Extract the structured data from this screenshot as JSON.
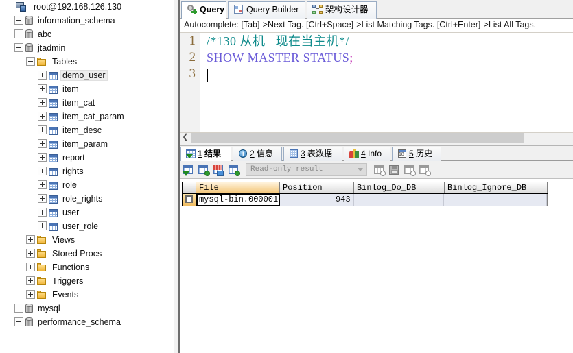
{
  "tree": {
    "root": {
      "label": "root@192.168.126.130",
      "icon": "server-icon"
    },
    "nodes": [
      {
        "label": "information_schema",
        "icon": "database-icon",
        "indent": 1,
        "toggle": "plus"
      },
      {
        "label": "abc",
        "icon": "database-icon",
        "indent": 1,
        "toggle": "plus"
      },
      {
        "label": "jtadmin",
        "icon": "database-icon",
        "indent": 1,
        "toggle": "minus"
      },
      {
        "label": "Tables",
        "icon": "folder-icon",
        "indent": 2,
        "toggle": "minus"
      },
      {
        "label": "demo_user",
        "icon": "table-icon",
        "indent": 3,
        "toggle": "plus",
        "selected": true
      },
      {
        "label": "item",
        "icon": "table-icon",
        "indent": 3,
        "toggle": "plus"
      },
      {
        "label": "item_cat",
        "icon": "table-icon",
        "indent": 3,
        "toggle": "plus"
      },
      {
        "label": "item_cat_param",
        "icon": "table-icon",
        "indent": 3,
        "toggle": "plus"
      },
      {
        "label": "item_desc",
        "icon": "table-icon",
        "indent": 3,
        "toggle": "plus"
      },
      {
        "label": "item_param",
        "icon": "table-icon",
        "indent": 3,
        "toggle": "plus"
      },
      {
        "label": "report",
        "icon": "table-icon",
        "indent": 3,
        "toggle": "plus"
      },
      {
        "label": "rights",
        "icon": "table-icon",
        "indent": 3,
        "toggle": "plus"
      },
      {
        "label": "role",
        "icon": "table-icon",
        "indent": 3,
        "toggle": "plus"
      },
      {
        "label": "role_rights",
        "icon": "table-icon",
        "indent": 3,
        "toggle": "plus"
      },
      {
        "label": "user",
        "icon": "table-icon",
        "indent": 3,
        "toggle": "plus"
      },
      {
        "label": "user_role",
        "icon": "table-icon",
        "indent": 3,
        "toggle": "plus"
      },
      {
        "label": "Views",
        "icon": "folder-icon",
        "indent": 2,
        "toggle": "plus"
      },
      {
        "label": "Stored Procs",
        "icon": "folder-icon",
        "indent": 2,
        "toggle": "plus"
      },
      {
        "label": "Functions",
        "icon": "folder-icon",
        "indent": 2,
        "toggle": "plus"
      },
      {
        "label": "Triggers",
        "icon": "folder-icon",
        "indent": 2,
        "toggle": "plus"
      },
      {
        "label": "Events",
        "icon": "folder-icon",
        "indent": 2,
        "toggle": "plus"
      },
      {
        "label": "mysql",
        "icon": "database-icon",
        "indent": 1,
        "toggle": "plus"
      },
      {
        "label": "performance_schema",
        "icon": "database-icon",
        "indent": 1,
        "toggle": "plus"
      }
    ]
  },
  "tabs": [
    {
      "label": "Query",
      "icon": "query-icon",
      "active": true
    },
    {
      "label": "Query Builder",
      "icon": "query-builder-icon",
      "active": false
    },
    {
      "label": "架构设计器",
      "icon": "schema-designer-icon",
      "active": false
    }
  ],
  "autocomplete_hint": "Autocomplete: [Tab]->Next Tag. [Ctrl+Space]->List Matching Tags. [Ctrl+Enter]->List All Tags.",
  "editor": {
    "line_numbers": [
      "1",
      "2",
      "3"
    ],
    "lines": [
      {
        "comment": "/*130 从机   现在当主机*/"
      },
      {
        "keywords": "SHOW MASTER STATUS",
        "punct": ";"
      },
      {
        "empty": ""
      }
    ],
    "colors": {
      "comment": "#0d8a8a",
      "keyword": "#6a5bd8",
      "punctuation": "#c02ab0",
      "lineno": "#8a6b3a"
    }
  },
  "result_tabs": [
    {
      "num": "1",
      "label": "结果",
      "icon": "result-grid-icon",
      "active": true
    },
    {
      "num": "2",
      "label": "信息",
      "icon": "info-circle-icon",
      "active": false
    },
    {
      "num": "3",
      "label": "表数据",
      "icon": "table-data-icon",
      "active": false
    },
    {
      "num": "4",
      "label": "Info",
      "icon": "chart-icon",
      "active": false
    },
    {
      "num": "5",
      "label": "历史",
      "icon": "calendar-icon",
      "active": false
    }
  ],
  "result_toolbar": {
    "buttons_left": [
      {
        "name": "insert-record-button",
        "icon": "grid-plus-icon",
        "enabled": true
      },
      {
        "name": "duplicate-record-button",
        "icon": "grid-copy-icon",
        "enabled": true
      },
      {
        "name": "edit-record-button",
        "icon": "grid-edit-icon",
        "enabled": true
      },
      {
        "name": "post-record-button",
        "icon": "grid-post-icon",
        "enabled": true
      }
    ],
    "mode_select": {
      "value": "Read-only result",
      "name": "result-mode-select"
    },
    "buttons_right": [
      {
        "name": "refresh-data-button",
        "icon": "grid-refresh-icon",
        "enabled": false
      },
      {
        "name": "save-data-button",
        "icon": "floppy-disk-icon",
        "enabled": false
      },
      {
        "name": "export-data-button",
        "icon": "grid-export-icon",
        "enabled": false
      },
      {
        "name": "cancel-changes-button",
        "icon": "grid-cancel-icon",
        "enabled": false
      }
    ]
  },
  "result_grid": {
    "columns": [
      "File",
      "Position",
      "Binlog_Do_DB",
      "Binlog_Ignore_DB"
    ],
    "sorted_column": "File",
    "rows": [
      {
        "selected": true,
        "cells": [
          "mysql-bin.000001",
          "943",
          "",
          ""
        ]
      }
    ]
  }
}
